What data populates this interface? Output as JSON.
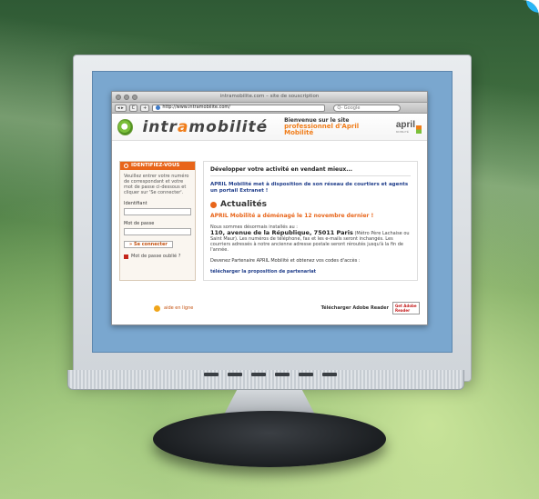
{
  "browser": {
    "window_title": "intramobilite.com – site de souscription",
    "url": "http://www.intramobilite.com/",
    "search_placeholder": "Q- Google",
    "back_label": "◂ ▸",
    "reload_label": "C",
    "add_label": "+"
  },
  "site": {
    "logo_prefix": "intr",
    "logo_accent": "a",
    "logo_suffix": "mobilité",
    "welcome_line1": "Bienvenue sur le site",
    "welcome_line2": "professionnel d'April Mobilité",
    "brand": "april",
    "brand_small": "MOBILITÉ"
  },
  "login": {
    "heading": "IDENTIFIEZ-VOUS",
    "instructions": "Veuillez entrer votre numéro de correspondant et votre mot de passe ci-dessous et cliquer sur 'Se connecter'.",
    "id_label": "Identifiant",
    "password_label": "Mot de passe",
    "connect_label": "» Se connecter",
    "forgot_label": "Mot de passe oublié ?"
  },
  "main": {
    "heading": "Développer votre activité en vendant mieux...",
    "intro": "APRIL Mobilité met à disposition de son réseau de courtiers et agents un portail Extranet !",
    "news_title": "Actualités",
    "news_headline": "APRIL Mobilité a déménagé le 12 novembre dernier !",
    "news_p1": "Nous sommes désormais installés au :",
    "address": "110, avenue de la République, 75011 Paris",
    "address_note": "(Métro Père Lachaise ou Saint Maur). Les numéros de téléphone, fax et les e-mails seront inchangés. Les courriers adressés à notre ancienne adresse postale seront réroutés jusqu'à la fin de l'année.",
    "partner_text": "Devenez Partenaire APRIL Mobilité et obtenez vos codes d'accès :",
    "partner_link": "télécharger la proposition de partenariat"
  },
  "footer": {
    "help_label": "aide en ligne",
    "adobe_text": "Télécharger Adobe Reader",
    "adobe_badge_line1": "Get Adobe",
    "adobe_badge_line2": "Reader"
  },
  "colors": {
    "accent_orange": "#e8651a",
    "link_blue": "#1f3d8a",
    "logo_green": "#7bbf3a"
  }
}
